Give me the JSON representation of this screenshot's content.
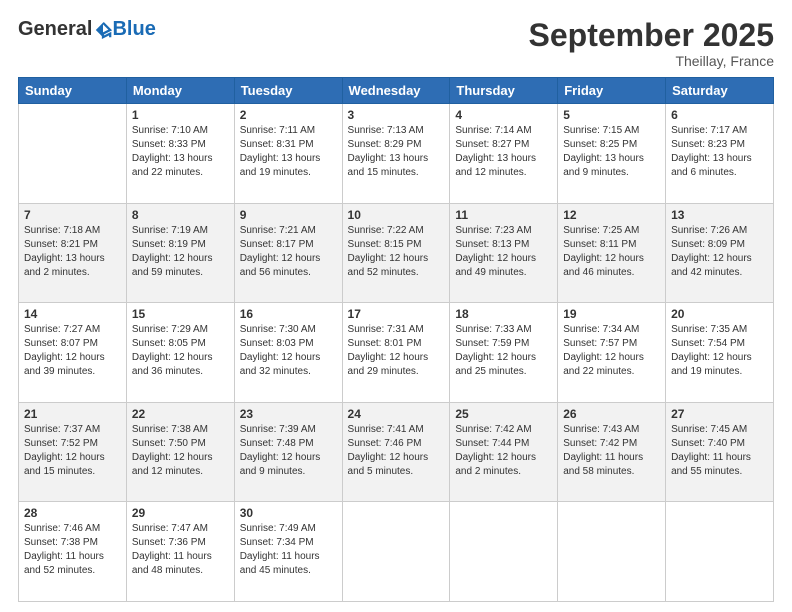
{
  "header": {
    "logo_general": "General",
    "logo_blue": "Blue",
    "month_title": "September 2025",
    "subtitle": "Theillay, France"
  },
  "days_of_week": [
    "Sunday",
    "Monday",
    "Tuesday",
    "Wednesday",
    "Thursday",
    "Friday",
    "Saturday"
  ],
  "weeks": [
    [
      {
        "day": "",
        "info": ""
      },
      {
        "day": "1",
        "info": "Sunrise: 7:10 AM\nSunset: 8:33 PM\nDaylight: 13 hours\nand 22 minutes."
      },
      {
        "day": "2",
        "info": "Sunrise: 7:11 AM\nSunset: 8:31 PM\nDaylight: 13 hours\nand 19 minutes."
      },
      {
        "day": "3",
        "info": "Sunrise: 7:13 AM\nSunset: 8:29 PM\nDaylight: 13 hours\nand 15 minutes."
      },
      {
        "day": "4",
        "info": "Sunrise: 7:14 AM\nSunset: 8:27 PM\nDaylight: 13 hours\nand 12 minutes."
      },
      {
        "day": "5",
        "info": "Sunrise: 7:15 AM\nSunset: 8:25 PM\nDaylight: 13 hours\nand 9 minutes."
      },
      {
        "day": "6",
        "info": "Sunrise: 7:17 AM\nSunset: 8:23 PM\nDaylight: 13 hours\nand 6 minutes."
      }
    ],
    [
      {
        "day": "7",
        "info": "Sunrise: 7:18 AM\nSunset: 8:21 PM\nDaylight: 13 hours\nand 2 minutes."
      },
      {
        "day": "8",
        "info": "Sunrise: 7:19 AM\nSunset: 8:19 PM\nDaylight: 12 hours\nand 59 minutes."
      },
      {
        "day": "9",
        "info": "Sunrise: 7:21 AM\nSunset: 8:17 PM\nDaylight: 12 hours\nand 56 minutes."
      },
      {
        "day": "10",
        "info": "Sunrise: 7:22 AM\nSunset: 8:15 PM\nDaylight: 12 hours\nand 52 minutes."
      },
      {
        "day": "11",
        "info": "Sunrise: 7:23 AM\nSunset: 8:13 PM\nDaylight: 12 hours\nand 49 minutes."
      },
      {
        "day": "12",
        "info": "Sunrise: 7:25 AM\nSunset: 8:11 PM\nDaylight: 12 hours\nand 46 minutes."
      },
      {
        "day": "13",
        "info": "Sunrise: 7:26 AM\nSunset: 8:09 PM\nDaylight: 12 hours\nand 42 minutes."
      }
    ],
    [
      {
        "day": "14",
        "info": "Sunrise: 7:27 AM\nSunset: 8:07 PM\nDaylight: 12 hours\nand 39 minutes."
      },
      {
        "day": "15",
        "info": "Sunrise: 7:29 AM\nSunset: 8:05 PM\nDaylight: 12 hours\nand 36 minutes."
      },
      {
        "day": "16",
        "info": "Sunrise: 7:30 AM\nSunset: 8:03 PM\nDaylight: 12 hours\nand 32 minutes."
      },
      {
        "day": "17",
        "info": "Sunrise: 7:31 AM\nSunset: 8:01 PM\nDaylight: 12 hours\nand 29 minutes."
      },
      {
        "day": "18",
        "info": "Sunrise: 7:33 AM\nSunset: 7:59 PM\nDaylight: 12 hours\nand 25 minutes."
      },
      {
        "day": "19",
        "info": "Sunrise: 7:34 AM\nSunset: 7:57 PM\nDaylight: 12 hours\nand 22 minutes."
      },
      {
        "day": "20",
        "info": "Sunrise: 7:35 AM\nSunset: 7:54 PM\nDaylight: 12 hours\nand 19 minutes."
      }
    ],
    [
      {
        "day": "21",
        "info": "Sunrise: 7:37 AM\nSunset: 7:52 PM\nDaylight: 12 hours\nand 15 minutes."
      },
      {
        "day": "22",
        "info": "Sunrise: 7:38 AM\nSunset: 7:50 PM\nDaylight: 12 hours\nand 12 minutes."
      },
      {
        "day": "23",
        "info": "Sunrise: 7:39 AM\nSunset: 7:48 PM\nDaylight: 12 hours\nand 9 minutes."
      },
      {
        "day": "24",
        "info": "Sunrise: 7:41 AM\nSunset: 7:46 PM\nDaylight: 12 hours\nand 5 minutes."
      },
      {
        "day": "25",
        "info": "Sunrise: 7:42 AM\nSunset: 7:44 PM\nDaylight: 12 hours\nand 2 minutes."
      },
      {
        "day": "26",
        "info": "Sunrise: 7:43 AM\nSunset: 7:42 PM\nDaylight: 11 hours\nand 58 minutes."
      },
      {
        "day": "27",
        "info": "Sunrise: 7:45 AM\nSunset: 7:40 PM\nDaylight: 11 hours\nand 55 minutes."
      }
    ],
    [
      {
        "day": "28",
        "info": "Sunrise: 7:46 AM\nSunset: 7:38 PM\nDaylight: 11 hours\nand 52 minutes."
      },
      {
        "day": "29",
        "info": "Sunrise: 7:47 AM\nSunset: 7:36 PM\nDaylight: 11 hours\nand 48 minutes."
      },
      {
        "day": "30",
        "info": "Sunrise: 7:49 AM\nSunset: 7:34 PM\nDaylight: 11 hours\nand 45 minutes."
      },
      {
        "day": "",
        "info": ""
      },
      {
        "day": "",
        "info": ""
      },
      {
        "day": "",
        "info": ""
      },
      {
        "day": "",
        "info": ""
      }
    ]
  ]
}
